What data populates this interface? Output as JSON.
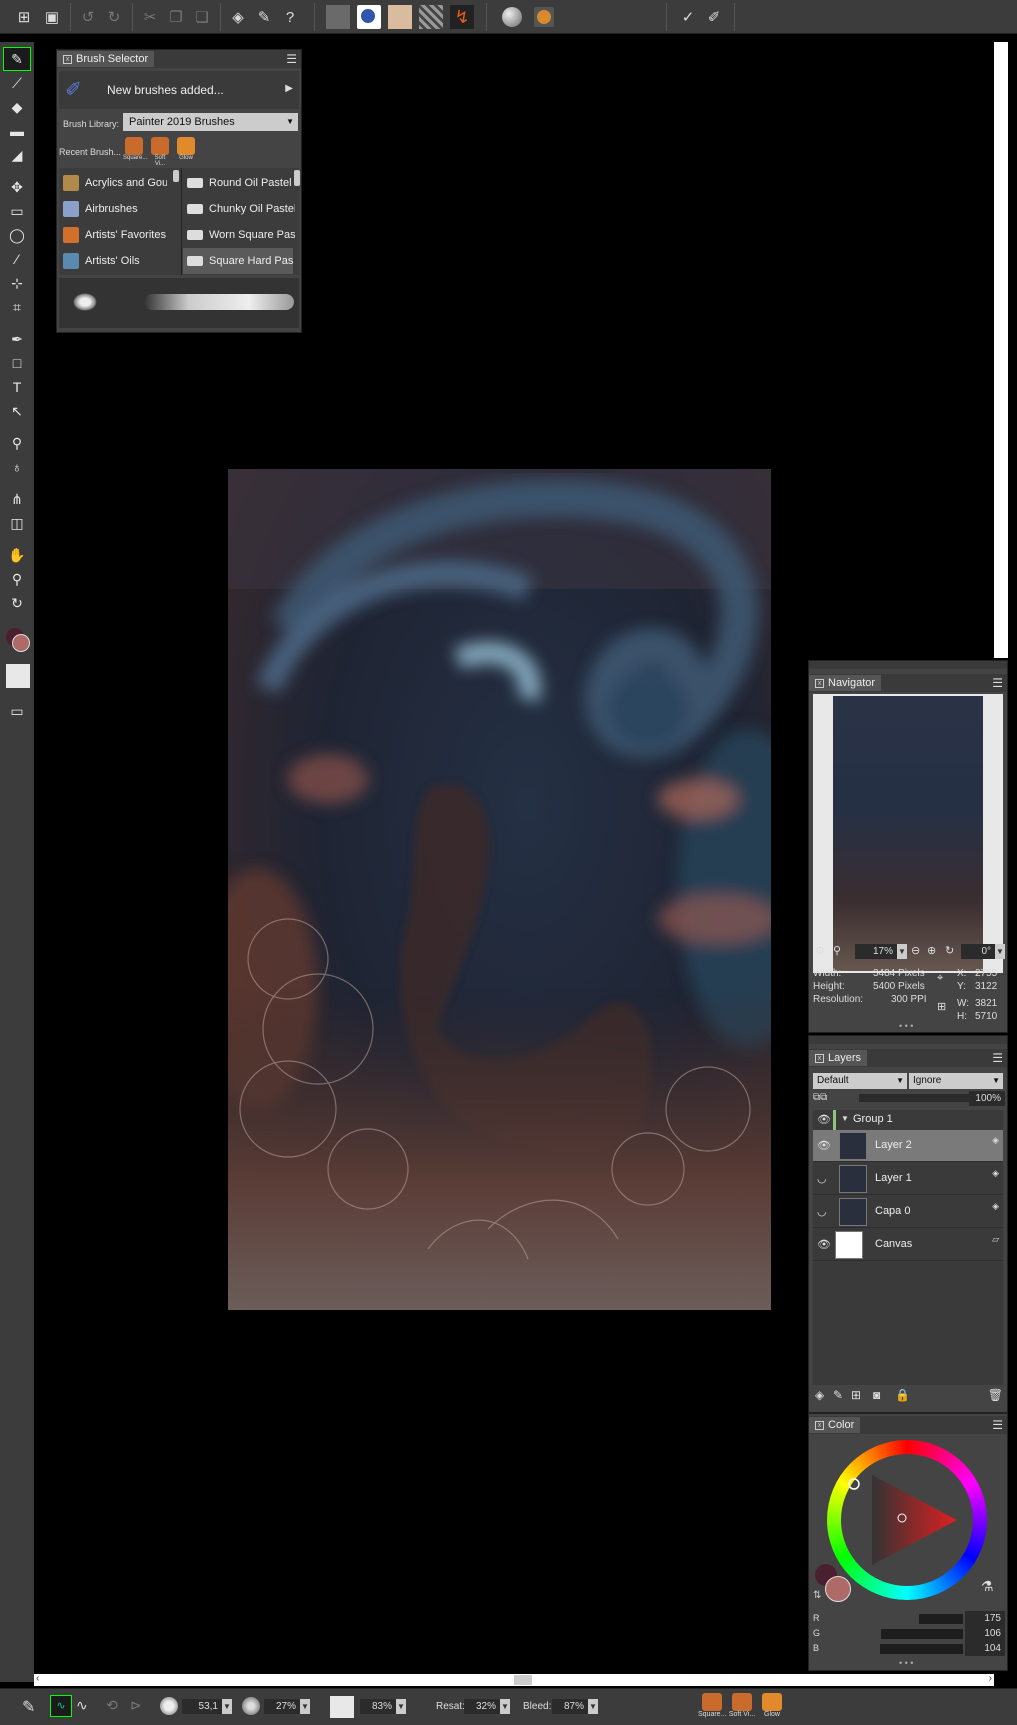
{
  "toolbar": {
    "icons": [
      "new-document-icon",
      "save-icon",
      "undo-icon",
      "redo-icon",
      "cut-icon",
      "copy-icon",
      "paste-icon",
      "layers-icon",
      "brush-icon",
      "help-icon",
      "paper-texture-icon",
      "flow-map-icon",
      "paper-icon",
      "grain-icon",
      "brush-stroke-icon",
      "dab-icon",
      "color-icon",
      "brush-tracking-icon",
      "brush-control-icon"
    ]
  },
  "brush_selector": {
    "title": "Brush Selector",
    "banner": "New brushes added...",
    "library_label": "Brush Library:",
    "library_value": "Painter 2019 Brushes",
    "recent_label": "Recent Brush...",
    "recent": [
      "Square...",
      "Soft Vi...",
      "Glow"
    ],
    "categories": [
      "Acrylics and Gouache",
      "Airbrushes",
      "Artists' Favorites",
      "Artists' Oils"
    ],
    "variants": [
      "Round Oil Pastel",
      "Chunky Oil Pastel",
      "Worn Square Pastel",
      "Square Hard Pastel"
    ]
  },
  "navigator": {
    "title": "Navigator",
    "zoom": "17%",
    "rotation": "0°",
    "width_label": "Width:",
    "width_value": "3484 Pixels",
    "height_label": "Height:",
    "height_value": "5400 Pixels",
    "resolution_label": "Resolution:",
    "resolution_value": "300 PPI",
    "x_label": "X:",
    "x_value": "2755",
    "y_label": "Y:",
    "y_value": "3122",
    "w_label": "W:",
    "w_value": "3821",
    "h_label": "H:",
    "h_value": "5710"
  },
  "layers": {
    "title": "Layers",
    "composite_method": "Default",
    "preserve": "Ignore",
    "opacity": "100%",
    "group": "Group 1",
    "items": [
      {
        "name": "Layer 2",
        "visible": true,
        "selected": true
      },
      {
        "name": "Layer 1",
        "visible": false,
        "selected": false
      },
      {
        "name": "Capa 0",
        "visible": false,
        "selected": false
      },
      {
        "name": "Canvas",
        "visible": true,
        "selected": false
      }
    ]
  },
  "color": {
    "title": "Color",
    "r_label": "R",
    "r": "175",
    "g_label": "G",
    "g": "106",
    "b_label": "B",
    "b": "104",
    "r_fraction": 0.686,
    "g_fraction": 0.416,
    "b_fraction": 0.408,
    "main_color": "#af6a68",
    "secondary_color": "#4a1f30"
  },
  "property_bar": {
    "size": "53,1",
    "opacity": "27%",
    "grain": "83%",
    "resat_label": "Resat:",
    "resat": "32%",
    "bleed_label": "Bleed:",
    "bleed": "87%",
    "recent": [
      "Square...",
      "Soft Vi...",
      "Glow"
    ]
  }
}
